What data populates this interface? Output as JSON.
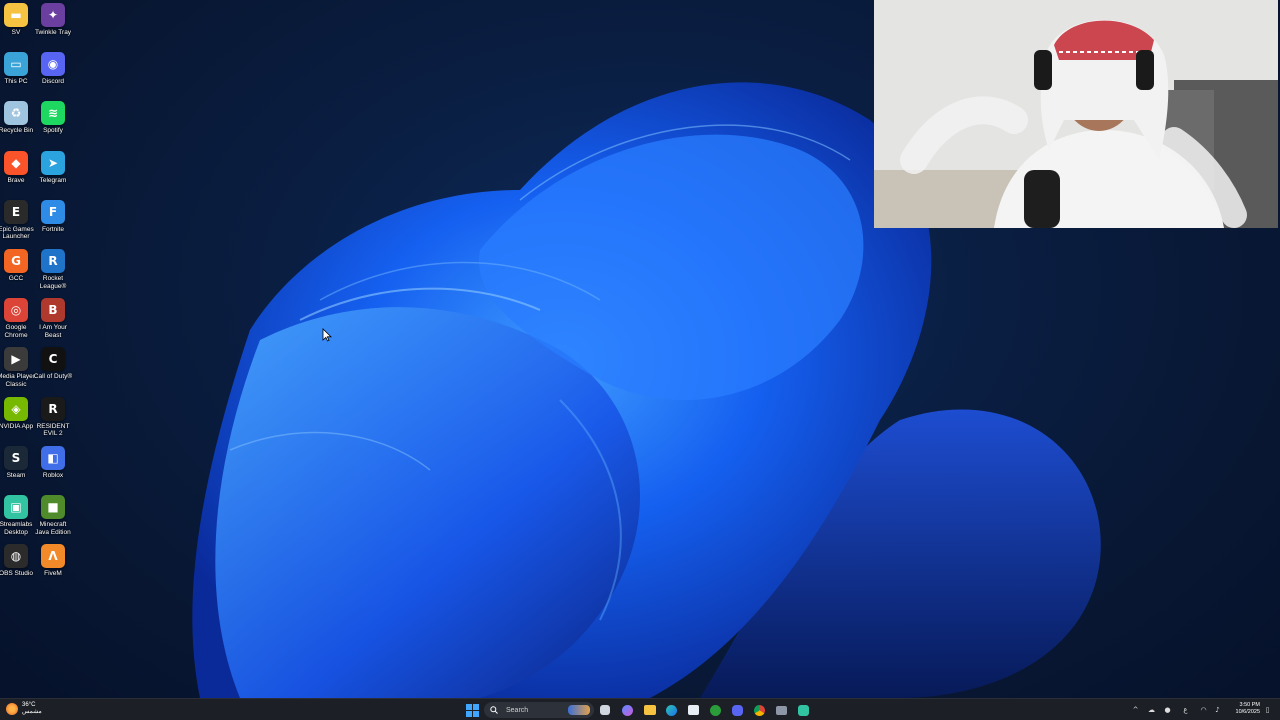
{
  "desktop": {
    "icons": [
      {
        "label": "SV",
        "icon": "folder-icon",
        "color": "#f5c242"
      },
      {
        "label": "Twinkle Tray",
        "icon": "twinkle-tray-icon",
        "color": "#6b3fa0"
      },
      {
        "label": "This PC",
        "icon": "this-pc-icon",
        "color": "#3aa4d8"
      },
      {
        "label": "Discord",
        "icon": "discord-icon",
        "color": "#5865f2"
      },
      {
        "label": "Recycle Bin",
        "icon": "recycle-bin-icon",
        "color": "#9fc4e0"
      },
      {
        "label": "Spotify",
        "icon": "spotify-icon",
        "color": "#1ed760"
      },
      {
        "label": "Brave",
        "icon": "brave-icon",
        "color": "#fb542b"
      },
      {
        "label": "Telegram",
        "icon": "telegram-icon",
        "color": "#2aa3df"
      },
      {
        "label": "Epic Games Launcher",
        "icon": "epic-games-icon",
        "color": "#2a2a2a"
      },
      {
        "label": "Fortnite",
        "icon": "fortnite-icon",
        "color": "#2e8be6"
      },
      {
        "label": "GCC",
        "icon": "gcc-icon",
        "color": "#f26522"
      },
      {
        "label": "Rocket League®",
        "icon": "rocket-league-icon",
        "color": "#1f74c9"
      },
      {
        "label": "Google Chrome",
        "icon": "chrome-icon",
        "color": "#db4437"
      },
      {
        "label": "I Am Your Beast",
        "icon": "i-am-your-beast-icon",
        "color": "#b0392e"
      },
      {
        "label": "Media Player Classic",
        "icon": "media-player-classic-icon",
        "color": "#3b3b3b"
      },
      {
        "label": "Call of Duty®",
        "icon": "call-of-duty-icon",
        "color": "#111111"
      },
      {
        "label": "NVIDIA App",
        "icon": "nvidia-icon",
        "color": "#76b900"
      },
      {
        "label": "RESIDENT EVIL 2",
        "icon": "resident-evil-icon",
        "color": "#1a1a1a"
      },
      {
        "label": "Steam",
        "icon": "steam-icon",
        "color": "#1b2838"
      },
      {
        "label": "Roblox",
        "icon": "roblox-icon",
        "color": "#3f6ee8"
      },
      {
        "label": "Streamlabs Desktop",
        "icon": "streamlabs-icon",
        "color": "#31c3a2"
      },
      {
        "label": "Minecraft Java Edition",
        "icon": "minecraft-icon",
        "color": "#4f8a2b"
      },
      {
        "label": "OBS Studio",
        "icon": "obs-icon",
        "color": "#2b2b2b"
      },
      {
        "label": "FiveM",
        "icon": "fivem-icon",
        "color": "#f38a2a"
      }
    ]
  },
  "taskbar": {
    "weather_temp": "36°C",
    "weather_desc": "مشمس",
    "search_label": "Search",
    "apps": [
      "windows-start-icon",
      "search-icon",
      "widget-icon",
      "task-view-icon",
      "copilot-icon",
      "file-explorer-icon",
      "edge-icon",
      "store-icon",
      "xbox-icon",
      "discord-icon",
      "chrome-icon",
      "camera-icon",
      "streamlabs-icon"
    ],
    "clock_time": "3:50 PM",
    "clock_date": "10/6/2025",
    "lang": "ع",
    "colors": {
      "start": "#0a84ff",
      "bg": "#1c1f26"
    }
  }
}
